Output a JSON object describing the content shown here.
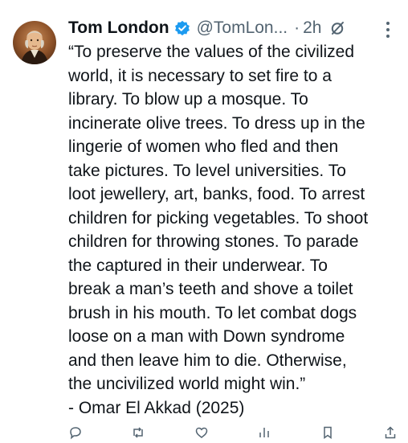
{
  "author": {
    "name": "Tom London",
    "handle": "@TomLon...",
    "separator": "·",
    "time": "2h"
  },
  "icons": {
    "verified": "verified-badge-icon",
    "grok": "grok-icon",
    "more": "more-options-icon",
    "reply": "reply-icon",
    "repost": "repost-icon",
    "like": "like-icon",
    "views": "views-icon",
    "bookmark": "bookmark-icon",
    "share": "share-icon"
  },
  "colors": {
    "verified_blue": "#1d9bf0",
    "secondary_text": "#536471"
  },
  "tweet": {
    "text": "“To preserve the values of the civilized\nworld, it is necessary to set fire to a\nlibrary. To blow up a mosque. To\nincinerate olive trees. To dress up in the\nlingerie of women who fled and then\ntake pictures. To level universities. To\nloot jewellery, art, banks, food. To arrest\nchildren for picking vegetables. To shoot\nchildren for throwing stones. To parade\nthe captured in their underwear. To\nbreak a man’s teeth and shove a toilet\nbrush in his mouth. To let combat dogs\nloose on a man with Down syndrome\nand then leave him to die. Otherwise,\nthe uncivilized world might win.”\n- Omar El Akkad (2025)"
  }
}
